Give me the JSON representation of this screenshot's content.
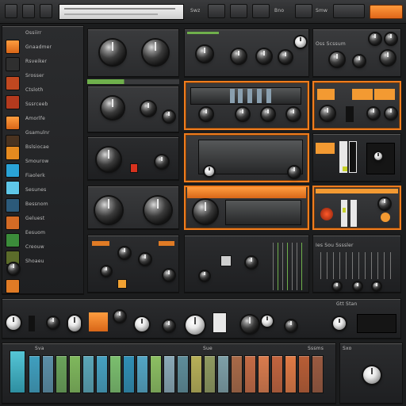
{
  "colors": {
    "accent_orange": "#f07c1d",
    "display_white": "#e6e6e6",
    "panel_dark": "#2a2b2d",
    "key_cyan": "#44b8c6",
    "key_green": "#6fb04c",
    "key_orange": "#e07a45"
  },
  "topbar": {
    "display_line_1": "",
    "display_line_2": "",
    "label_1": "Swz",
    "label_2": "Bno",
    "label_3": "Smw"
  },
  "sidebar": {
    "items": [
      {
        "label": "Ossiirr"
      },
      {
        "label": "Gnaadmer"
      },
      {
        "label": "Rsveiker"
      },
      {
        "label": "Srosser"
      },
      {
        "label": "Ctsloth"
      },
      {
        "label": "Sssrceeb"
      },
      {
        "label": "Amorlfe"
      },
      {
        "label": "Gsamulnr"
      },
      {
        "label": "Bslsiocae"
      },
      {
        "label": "Smourow"
      },
      {
        "label": "Fiaolerk"
      },
      {
        "label": "Sesunes"
      },
      {
        "label": "Bessnom"
      },
      {
        "label": "Geluest"
      },
      {
        "label": "Eesuom"
      },
      {
        "label": "Creouw"
      },
      {
        "label": "Shoaeu"
      }
    ]
  },
  "modules": {
    "right_top_label": "Oss Scssum",
    "right_mid_label": "Ies Sou Ssssler",
    "bottom_label": "Sxo",
    "bottom_right_label": "Gtt Stan",
    "kbd_label_1": "Sva",
    "kbd_label_2": "Sue",
    "kbd_label_3": "Sssms"
  },
  "keyboard": {
    "keys": [
      "#3f9fbf",
      "#5b8fa8",
      "#6aa35a",
      "#7fb85c",
      "#5aa6b8",
      "#46a1c1",
      "#7bbf6e",
      "#2f8fb5",
      "#53a5c4",
      "#8cbf62",
      "#8aa9b7",
      "#5e8d9a",
      "#b7b058",
      "#8f9a60",
      "#7ea0a8",
      "#a96a48",
      "#c46b45",
      "#d97b4d",
      "#c2643e",
      "#e07a45",
      "#b85d35",
      "#9a5a40"
    ]
  }
}
